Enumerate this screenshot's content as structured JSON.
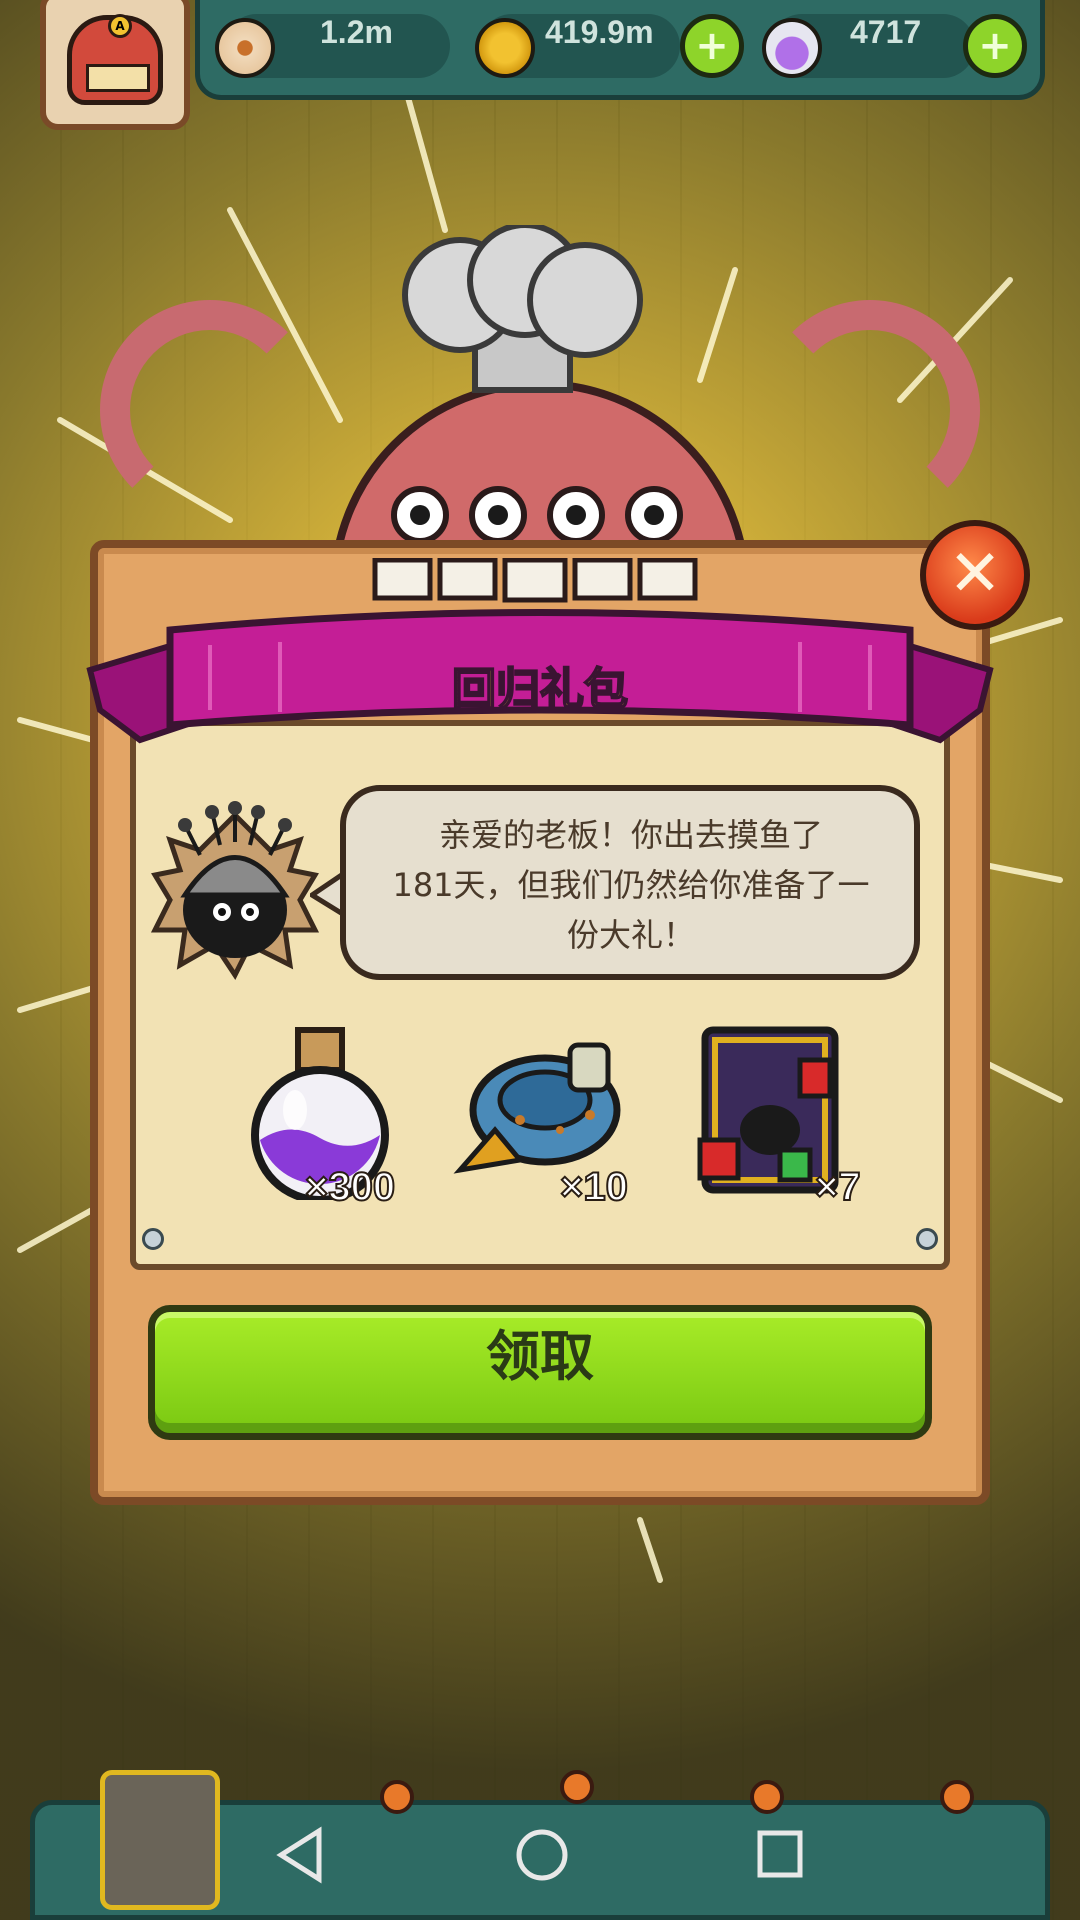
{
  "hud": {
    "eyes_value": "1.2m",
    "coins_value": "419.9m",
    "potions_value": "4717",
    "plus_symbol": "+"
  },
  "dialog": {
    "title": "回归礼包",
    "close_symbol": "✕",
    "message_line1": "亲爱的老板！你出去摸鱼了",
    "message_line2": "181天，但我们仍然给你准备了一",
    "message_line3": "份大礼！",
    "rewards": [
      {
        "icon": "purple-potion-icon",
        "count": "×300"
      },
      {
        "icon": "blue-scroll-bundle-icon",
        "count": "×10"
      },
      {
        "icon": "gift-card-icon",
        "count": "×7"
      }
    ],
    "claim_label": "领取"
  },
  "colors": {
    "ribbon": "#c41e96",
    "claim_button": "#8fdc1c",
    "hud_bar": "#2e6b64",
    "title_text": "#ffe93a"
  }
}
